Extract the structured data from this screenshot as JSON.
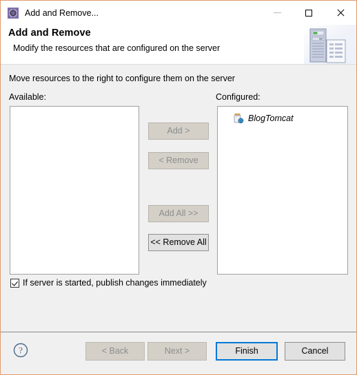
{
  "window": {
    "title": "Add and Remove...",
    "icon": "eclipse-wizard-icon",
    "border_color": "#e09a6e",
    "controls": {
      "minimize": "minimize-icon",
      "maximize": "maximize-icon",
      "close": "close-icon"
    }
  },
  "header": {
    "title": "Add and Remove",
    "description": "Modify the resources that are configured on the server",
    "art": "server-and-document-icon"
  },
  "main": {
    "instruction": "Move resources to the right to configure them on the server",
    "available": {
      "label": "Available:",
      "items": []
    },
    "configured": {
      "label": "Configured:",
      "items": [
        {
          "name": "BlogTomcat",
          "icon": "web-module-icon"
        }
      ]
    },
    "transfer_buttons": [
      {
        "label": "Add >",
        "enabled": false
      },
      {
        "label": "< Remove",
        "enabled": false
      },
      {
        "label": "Add All >>",
        "enabled": false
      },
      {
        "label": "<< Remove All",
        "enabled": true
      }
    ],
    "publish_checkbox": {
      "label": "If server is started, publish changes immediately",
      "checked": true
    }
  },
  "footer": {
    "help": "help-icon",
    "buttons": [
      {
        "label": "< Back",
        "enabled": false,
        "focused": false
      },
      {
        "label": "Next >",
        "enabled": false,
        "focused": false
      },
      {
        "label": "Finish",
        "enabled": true,
        "focused": true
      },
      {
        "label": "Cancel",
        "enabled": true,
        "focused": false
      }
    ]
  },
  "colors": {
    "accent": "#0078d7",
    "dialog_bg": "#f0f0f0",
    "field_bg": "#ffffff"
  }
}
